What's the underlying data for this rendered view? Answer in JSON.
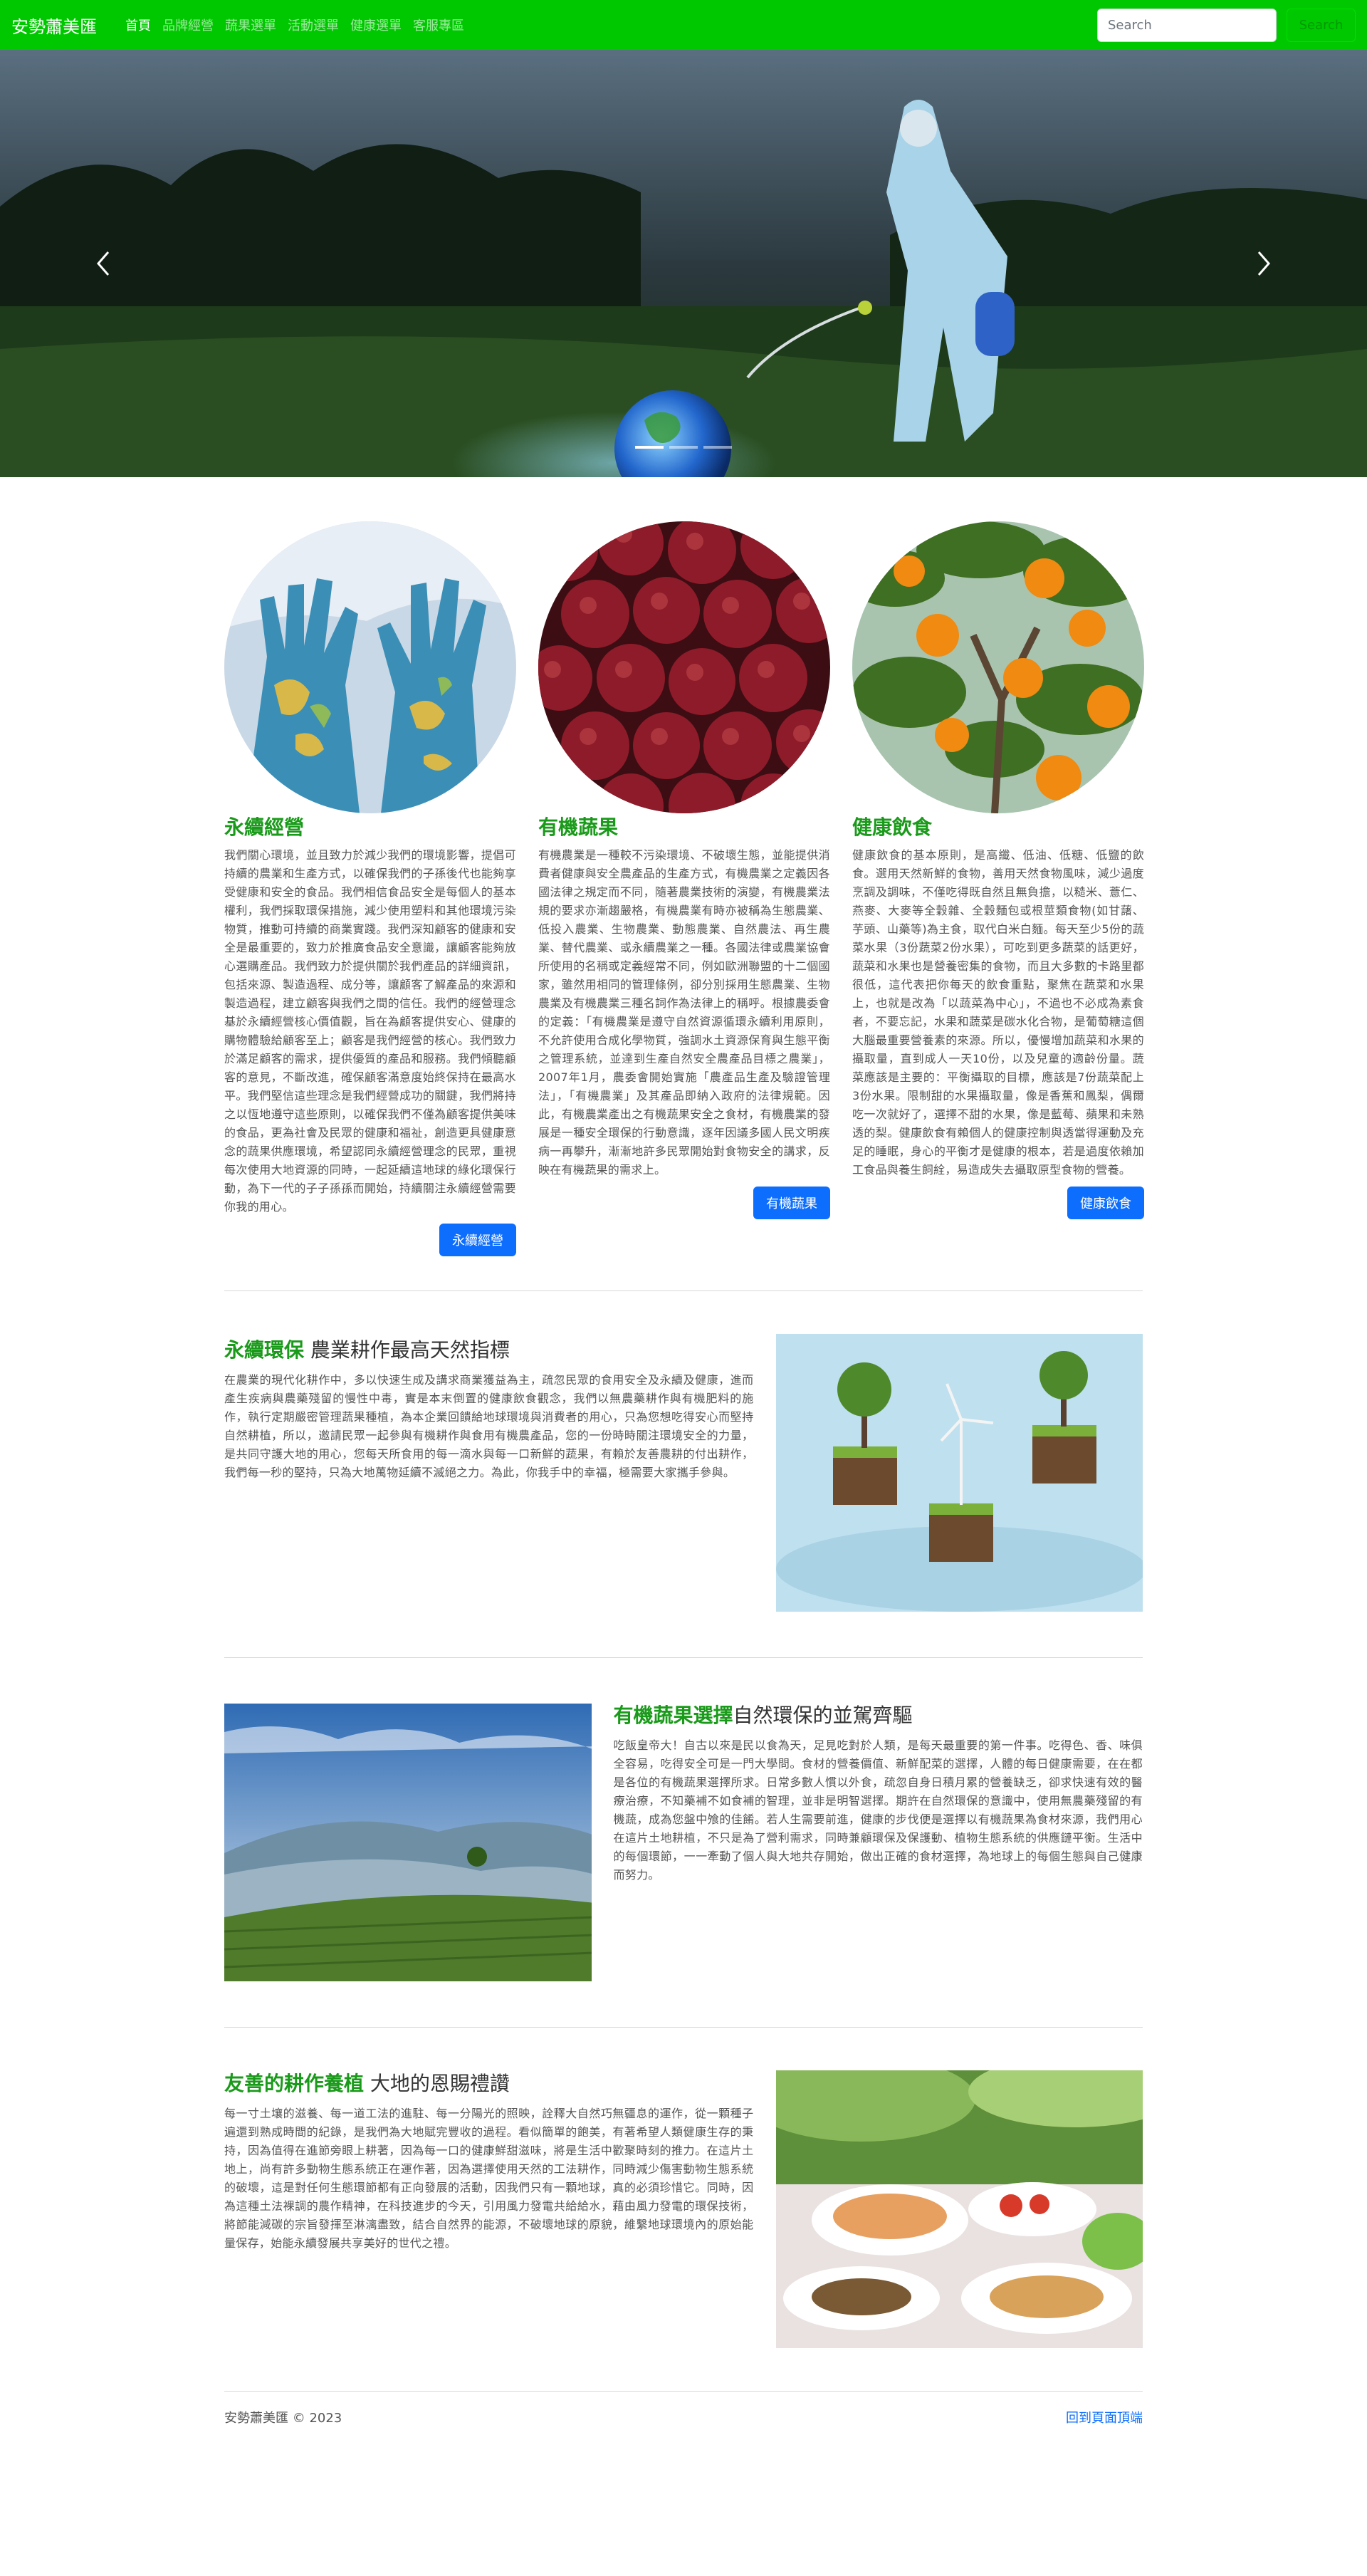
{
  "navbar": {
    "brand": "安勢蕭美匯",
    "links": [
      "首頁",
      "品牌經營",
      "蔬果選單",
      "活動選單",
      "健康選單",
      "客服專區"
    ],
    "search_placeholder": "Search",
    "search_button": "Search"
  },
  "columns": [
    {
      "title": "永續經營",
      "text": "我們關心環境，並且致力於減少我們的環境影響，提倡可持續的農業和生產方式，以確保我們的子孫後代也能夠享受健康和安全的食品。我們相信食品安全是每個人的基本權利，我們採取環保措施，減少使用塑料和其他環境污染物質，推動可持續的商業實踐。我們深知顧客的健康和安全是最重要的，致力於推廣食品安全意識，讓顧客能夠放心選購產品。我們致力於提供關於我們產品的詳細資訊，包括來源、製造過程、成分等，讓顧客了解產品的來源和製造過程，建立顧客與我們之間的信任。我們的經營理念基於永續經營核心價值觀，旨在為顧客提供安心、健康的購物體驗給顧客至上；顧客是我們經營的核心。我們致力於滿足顧客的需求，提供優質的產品和服務。我們傾聽顧客的意見，不斷改進，確保顧客滿意度始終保持在最高水平。我們堅信這些理念是我們經營成功的關鍵，我們將持之以恆地遵守這些原則，以確保我們不僅為顧客提供美味的食品，更為社會及民眾的健康和福祉，創造更具健康意念的蔬果供應環境，希望認同永續經營理念的民眾，重視每次使用大地資源的同時，一起延續這地球的綠化環保行動，為下一代的子子孫孫而開始，持續關注永續經營需要你我的用心。",
      "button": "永續經營"
    },
    {
      "title": "有機蔬果",
      "text": "有機農業是一種較不污染環境、不破壞生態，並能提供消費者健康與安全農產品的生產方式，有機農業之定義因各國法律之規定而不同，隨著農業技術的演變，有機農業法規的要求亦漸趨嚴格，有機農業有時亦被稱為生態農業、低投入農業、生物農業、動態農業、自然農法、再生農業、替代農業、或永續農業之一種。各國法律或農業協會所使用的名稱或定義經常不同，例如歐洲聯盟的十二個國家，雖然用相同的管理條例，卻分別採用生態農業、生物農業及有機農業三種名詞作為法律上的稱呼。根據農委會的定義：「有機農業是遵守自然資源循環永續利用原則，不允許使用合成化學物質，強調水土資源保育與生態平衡之管理系統，並達到生產自然安全農產品目標之農業」，2007年1月，農委會開始實施「農產品生產及驗證管理法」，「有機農業」及其產品即納入政府的法律規範。因此，有機農業產出之有機蔬果安全之食材，有機農業的發展是一種安全環保的行動意識，逐年因議多國人民文明疾病一再攀升，漸漸地許多民眾開始對食物安全的講求，反映在有機蔬果的需求上。",
      "button": "有機蔬果"
    },
    {
      "title": "健康飲食",
      "text": "健康飲食的基本原則，是高纖、低油、低糖、低鹽的飲食。選用天然新鮮的食物，善用天然食物風味，減少過度烹調及調味，不僅吃得既自然且無負擔，以糙米、薏仁、燕麥、大麥等全穀雜、全穀麵包或根莖類食物(如甘藷、芋頭、山藥等)為主食，取代白米白麵。每天至少5份的蔬菜水果（3份蔬菜2份水果），可吃到更多蔬菜的話更好，蔬菜和水果也是營養密集的食物，而且大多數的卡路里都很低，這代表把你每天的飲食重點，聚焦在蔬菜和水果上，也就是改為「以蔬菜為中心」，不過也不必成為素食者，不要忘記，水果和蔬菜是碳水化合物，是葡萄糖這個大腦最重要營養素的來源。所以，優慢增加蔬菜和水果的攝取量，直到成人一天10份，以及兒童的適齡份量。蔬菜應該是主要的：平衡攝取的目標，應該是7份蔬菜配上3份水果。限制甜的水果攝取量，像是香蕉和鳳梨，偶爾吃一次就好了，選擇不甜的水果，像是藍莓、蘋果和未熟透的梨。健康飲食有賴個人的健康控制與透當得運動及充足的睡眠，身心的平衡才是健康的根本，若是過度依賴加工食品與養生飼絟，易造成失去攝取原型食物的營養。",
      "button": "健康飲食"
    }
  ],
  "featurettes": [
    {
      "accent": "永續環保",
      "heading": " 農業耕作最高天然指標",
      "text": "在農業的現代化耕作中，多以快速生成及講求商業獲益為主，疏忽民眾的食用安全及永續及健康，進而產生疾病與農藥殘留的慢性中毒，實是本末倒置的健康飲食觀念，我們以無農藥耕作與有機肥料的施作，執行定期嚴密管理蔬果種植，為本企業回饋給地球環境與消費者的用心，只為您想吃得安心而堅持自然耕植，所以，邀請民眾一起參與有機耕作與食用有機農產品，您的一份時時關注環境安全的力量，是共同守護大地的用心，您每天所食用的每一滴水與每一口新鮮的蔬果，有賴於友善農耕的付出耕作，我們每一秒的堅持，只為大地萬物延續不滅絕之力。為此，你我手中的幸福，極需要大家攜手參與。"
    },
    {
      "accent": "有機蔬果選擇",
      "heading": "自然環保的並駕齊驅",
      "text": "吃飯皇帝大！自古以來是民以食為天，足見吃對於人類，是每天最重要的第一件事。吃得色、香、味俱全容易，吃得安全可是一門大學問。食材的營養價值、新鮮配菜的選擇，人體的每日健康需要，在在都是各位的有機蔬果選擇所求。日常多數人慣以外食，疏忽自身日積月累的營養缺乏，卻求快速有效的醫療治療，不知藥補不如食補的智理，並非是明智選擇。期許在自然環保的意識中，使用無農藥殘留的有機蔬，成為您盤中飧的佳餚。若人生需要前進，健康的步伐便是選擇以有機蔬果為食材來源，我們用心在這片土地耕植，不只是為了營利需求，同時兼顧環保及保護動、植物生態系統的供應鏈平衡。生活中的每個環節，一一牽動了個人與大地共存開始，做出正確的食材選擇，為地球上的每個生態與自己健康而努力。"
    },
    {
      "accent": "友善的耕作養植",
      "heading": " 大地的恩賜禮讚",
      "text": "每一寸土壤的滋養、每一道工法的進駐、每一分陽光的照映，詮釋大自然巧無疆息的運作，從一顆種子遍還到熟成時間的紀錄，是我們為大地賦完豐收的過程。看似簡單的飽美，有著希望人類健康生存的秉持，因為值得在進節旁眼上耕著，因為每一口的健康鮮甜滋味，將是生活中歡聚時刻的推力。在這片土地上，尚有許多動物生態系統正在運作著，因為選擇使用天然的工法耕作，同時減少傷害動物生態系統的破壞，這是對任何生態環節都有正向發展的活動，因我們只有一顆地球，真的必須珍惜它。同時，因為這種土法裸調的農作精神，在科技進步的今天，引用風力發電共給給水，藉由風力發電的環保技術，將節能減碳的宗旨發揮至淋漓盡致，結合自然界的能源，不破壞地球的原貌，維繫地球環境內的原始能量保存，始能永續發展共享美好的世代之禮。"
    }
  ],
  "footer": {
    "copyright": "安勢蕭美匯 © 2023",
    "back_to_top": "回到頁面頂端"
  }
}
